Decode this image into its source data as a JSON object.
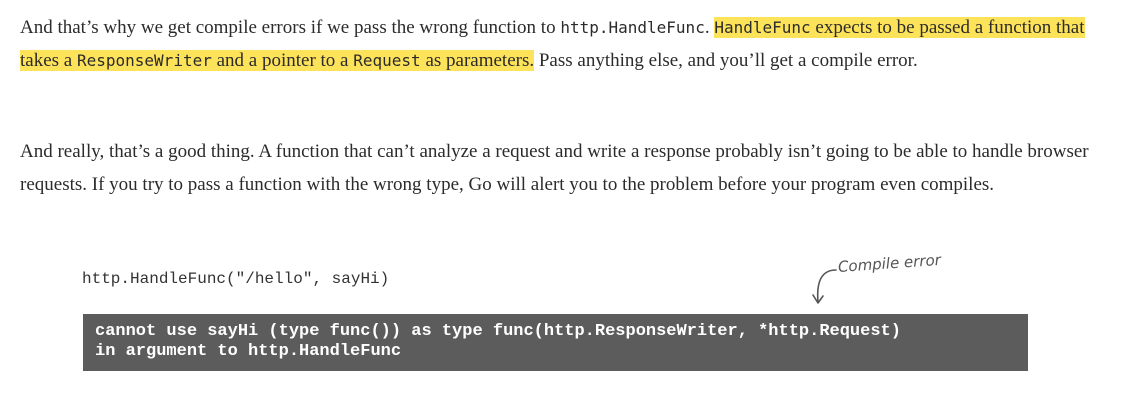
{
  "para1": {
    "t1": "And that’s why we get compile errors if we pass the wrong function to ",
    "c1": "http.HandleFunc",
    "t2": ". ",
    "hl_c1": "HandleFunc",
    "hl_t1": " expects to be passed a function that takes a ",
    "hl_c2": "ResponseWriter",
    "hl_t2": " and a pointer to a ",
    "hl_c3": "Request",
    "hl_t3": " as parameters.",
    "t3": " Pass anything else, and you’ll get a compile error."
  },
  "para2": {
    "text": "And really, that’s a good thing. A function that can’t analyze a request and write a response probably isn’t going to be able to handle browser requests. If you try to pass a function with the wrong type, Go will alert you to the problem before your program even compiles."
  },
  "code_example": "http.HandleFunc(\"/hello\", sayHi)",
  "annotation": "Compile error",
  "error_output": {
    "line1": "cannot use sayHi (type func()) as type func(http.ResponseWriter, *http.Request)",
    "line2": "in argument to http.HandleFunc"
  },
  "colors": {
    "highlight": "#fde35a",
    "error_box_bg": "#5c5c5c"
  }
}
